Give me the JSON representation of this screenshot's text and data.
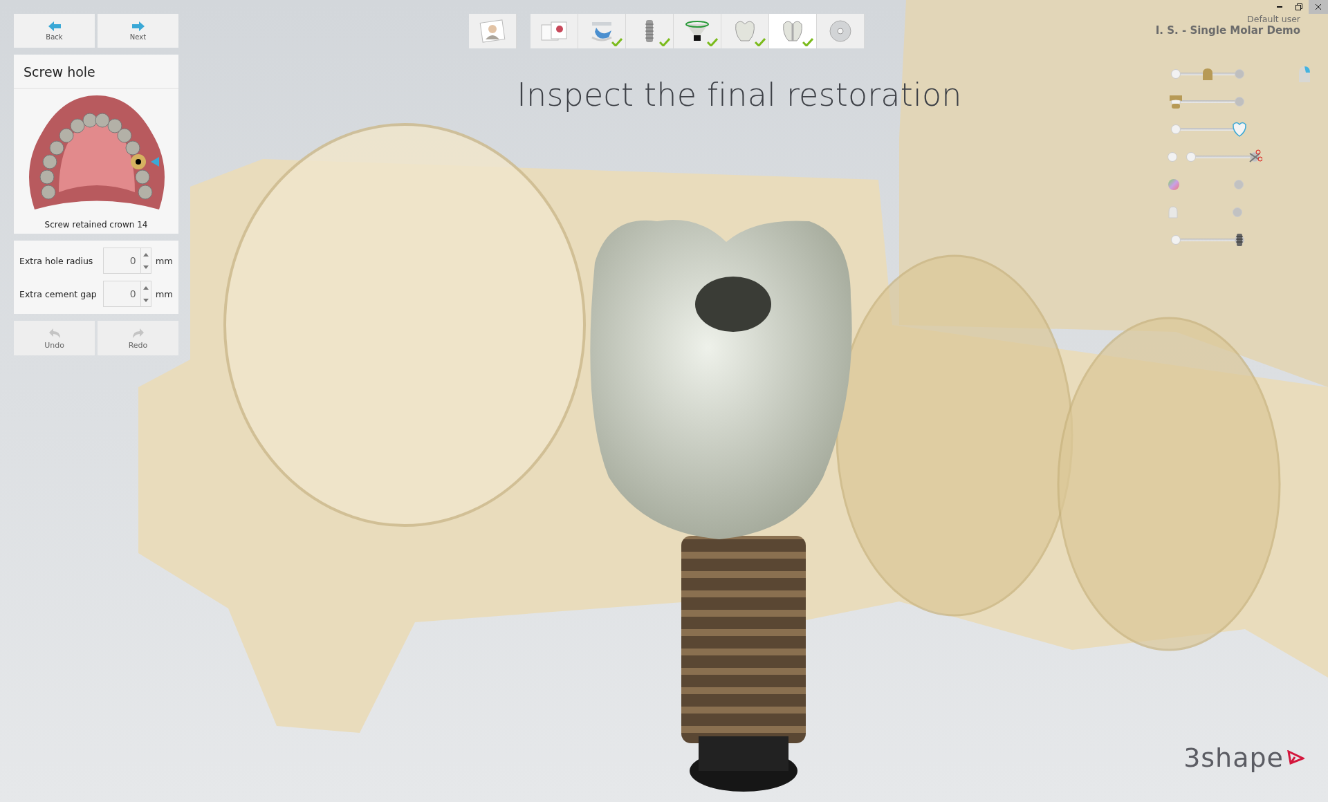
{
  "window": {
    "user": "Default user",
    "project": "I. S. - Single Molar Demo"
  },
  "nav": [
    {
      "kind": "back",
      "label": "Back"
    },
    {
      "kind": "next",
      "label": "Next"
    }
  ],
  "panel": {
    "title": "Screw hole",
    "caption": "Screw retained crown 14",
    "fields": [
      {
        "label": "Extra hole radius",
        "value": "0",
        "unit": "mm"
      },
      {
        "label": "Extra cement gap",
        "value": "0",
        "unit": "mm"
      }
    ]
  },
  "history": [
    {
      "kind": "undo",
      "label": "Undo",
      "disabled": true
    },
    {
      "kind": "redo",
      "label": "Redo",
      "disabled": true
    }
  ],
  "steps": [
    {
      "kind": "patient",
      "done": false,
      "selected": false
    },
    {
      "kind": "order",
      "done": false,
      "selected": false
    },
    {
      "kind": "scan",
      "done": true,
      "selected": false
    },
    {
      "kind": "implant",
      "done": true,
      "selected": false
    },
    {
      "kind": "abutment",
      "done": true,
      "selected": false
    },
    {
      "kind": "crown",
      "done": true,
      "selected": false
    },
    {
      "kind": "screwhole",
      "done": true,
      "selected": true
    },
    {
      "kind": "save",
      "done": false,
      "selected": false
    }
  ],
  "heading": "Inspect the final restoration",
  "view_controls": [
    {
      "kind": "slider",
      "level": 0.5
    },
    {
      "kind": "slider",
      "level": 0
    },
    {
      "kind": "slider",
      "level": 1
    },
    {
      "kind": "clip",
      "level": 1
    },
    {
      "kind": "toggle"
    },
    {
      "kind": "toggle"
    },
    {
      "kind": "slider",
      "level": 1
    }
  ],
  "logo": "3shape"
}
